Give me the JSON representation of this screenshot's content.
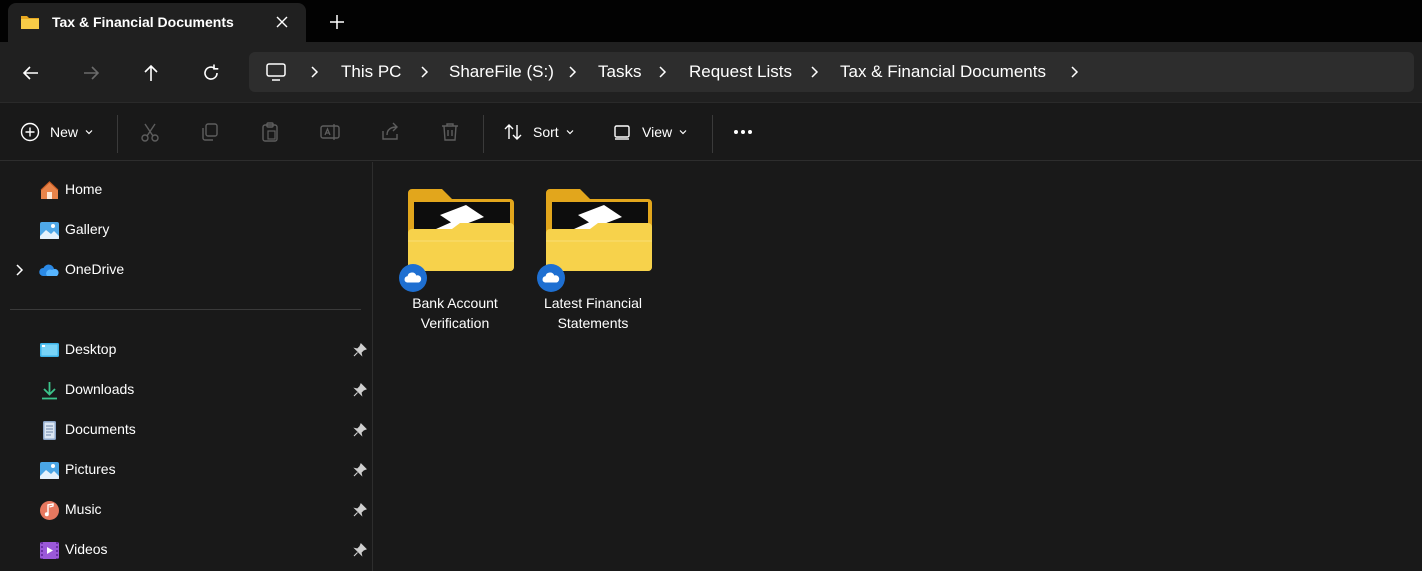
{
  "tab": {
    "title": "Tax & Financial Documents"
  },
  "address": {
    "crumbs": [
      "This PC",
      "ShareFile (S:)",
      "Tasks",
      "Request Lists",
      "Tax & Financial Documents"
    ]
  },
  "commands": {
    "new_label": "New",
    "sort_label": "Sort",
    "view_label": "View"
  },
  "sidebar": {
    "items": [
      {
        "label": "Home",
        "icon": "home-icon"
      },
      {
        "label": "Gallery",
        "icon": "gallery-icon"
      },
      {
        "label": "OneDrive",
        "icon": "onedrive-icon"
      },
      {
        "label": "Desktop",
        "icon": "desktop-icon",
        "pinned": true
      },
      {
        "label": "Downloads",
        "icon": "downloads-icon",
        "pinned": true
      },
      {
        "label": "Documents",
        "icon": "documents-icon",
        "pinned": true
      },
      {
        "label": "Pictures",
        "icon": "pictures-icon",
        "pinned": true
      },
      {
        "label": "Music",
        "icon": "music-icon",
        "pinned": true
      },
      {
        "label": "Videos",
        "icon": "videos-icon",
        "pinned": true
      }
    ]
  },
  "folders": [
    {
      "line1": "Bank Account",
      "line2": "Verification",
      "status": "cloud-icon"
    },
    {
      "line1": "Latest Financial",
      "line2": "Statements",
      "status": "cloud-icon"
    }
  ],
  "colors": {
    "folder": "#f2c230",
    "cloud_badge": "#1e6fd1",
    "background": "#191919"
  }
}
